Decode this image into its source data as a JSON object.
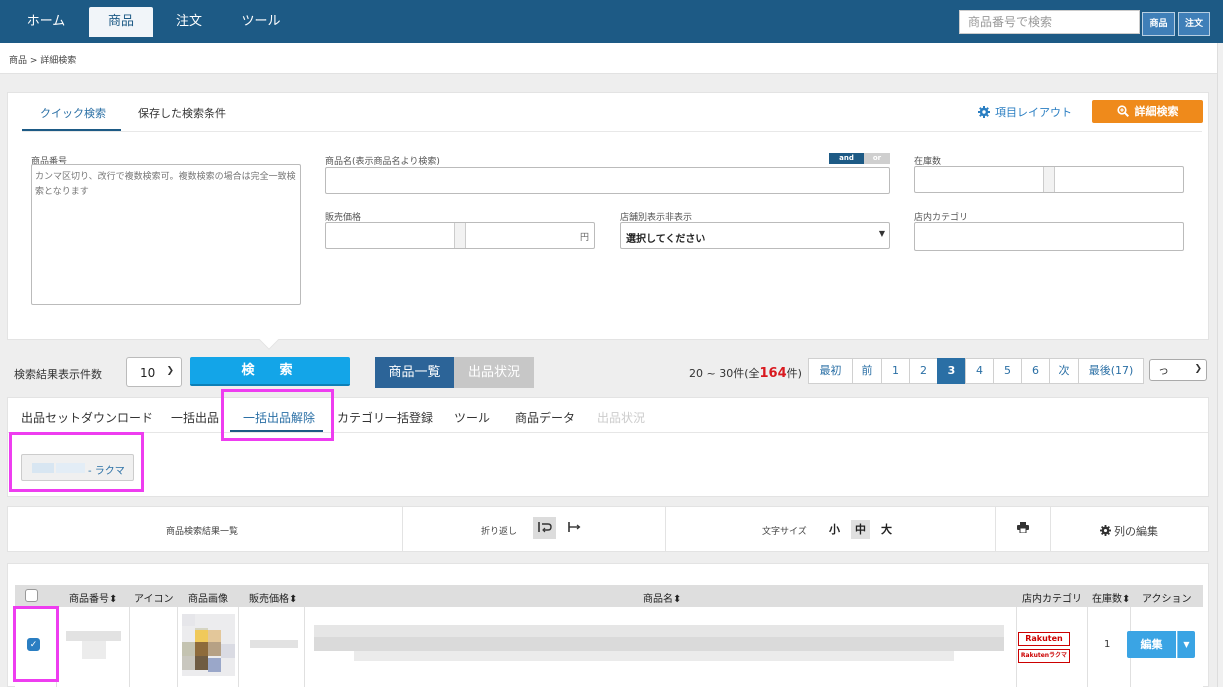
{
  "nav": {
    "tabs": [
      {
        "label": "ホーム"
      },
      {
        "label": "商品"
      },
      {
        "label": "注文"
      },
      {
        "label": "ツール"
      }
    ],
    "active": "商品",
    "search_placeholder": "商品番号で検索",
    "btn_product": "商品",
    "btn_order": "注文"
  },
  "breadcrumb": "商品 > 詳細検索",
  "search_panel": {
    "tab_quick": "クイック検索",
    "tab_saved": "保存した検索条件",
    "layout_link": "項目レイアウト",
    "detail_button": "詳細検索",
    "product_no_label": "商品番号",
    "product_no_placeholder": "カンマ区切り、改行で複数検索可。複数検索の場合は完全一致検索となります",
    "product_name_label": "商品名(表示商品名より検索)",
    "toggle_and": "and",
    "toggle_or": "or",
    "stock_label": "在庫数",
    "price_label": "販売価格",
    "price_unit": "円",
    "store_visibility_label": "店舗別表示非表示",
    "store_visibility_value": "選択してください",
    "store_category_label": "店内カテゴリ"
  },
  "results": {
    "count_label": "検索結果表示件数",
    "count_value": "10",
    "search_button": "検　索",
    "view_list": "商品一覧",
    "view_listing": "出品状況",
    "info_prefix": "20 ~ 30件(全",
    "info_total": "164",
    "info_suffix": "件)",
    "pages": [
      "最初",
      "前",
      "1",
      "2",
      "3",
      "4",
      "5",
      "6",
      "次",
      "最後(17)"
    ],
    "current_page": "3",
    "page_select": "っ"
  },
  "subtabs": {
    "items": [
      "出品セットダウンロード",
      "一括出品",
      "一括出品解除",
      "カテゴリ一括登録",
      "ツール",
      "商品データ",
      "出品状況"
    ],
    "active": "一括出品解除",
    "disabled": "出品状況",
    "rakuma_button": "- ラクマ"
  },
  "toolbar": {
    "title": "商品検索結果一覧",
    "wrap_label": "折り返し",
    "font_size_label": "文字サイズ",
    "font_small": "小",
    "font_mid": "中",
    "font_large": "大",
    "column_edit": "列の編集"
  },
  "table": {
    "headers": [
      "商品番号",
      "アイコン",
      "商品画像",
      "販売価格",
      "商品名",
      "店内カテゴリ",
      "在庫数",
      "アクション"
    ],
    "row": {
      "stock": "1",
      "badge_top": "Rakuten",
      "badge_bottom": "Rakutenラクマ",
      "edit_button": "編集"
    }
  },
  "colors": {
    "nav_bg": "#1d5a85",
    "accent_orange": "#ef8a1b",
    "search_button": "#13a5e8",
    "highlight": "#ee3df0",
    "total_red": "#d9191f"
  }
}
